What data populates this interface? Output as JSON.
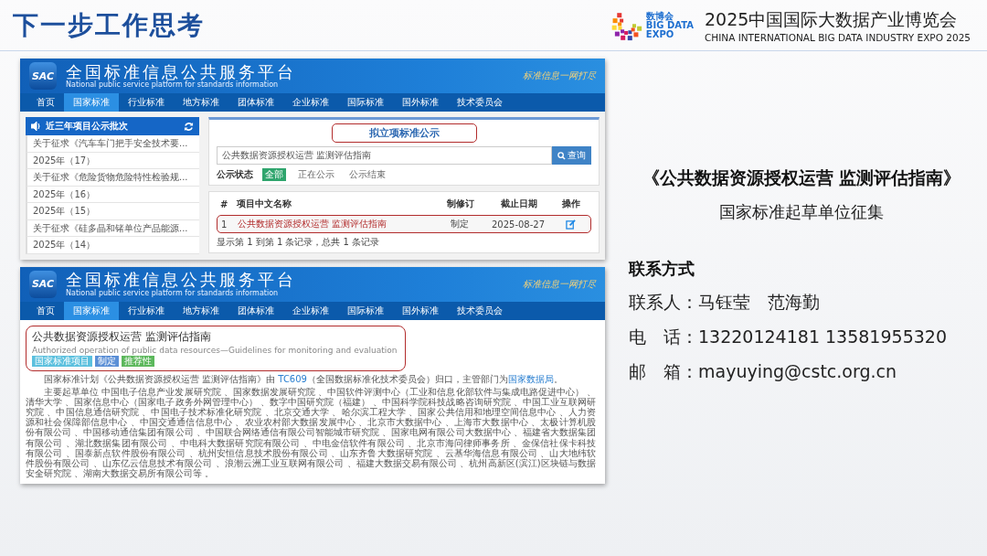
{
  "slide": {
    "title": "下一步工作思考",
    "expo": {
      "badge_lines": [
        "数博会",
        "BIG DATA",
        "EXPO"
      ],
      "title": "2025中国国际大数据产业博览会",
      "subtitle": "CHINA INTERNATIONAL BIG DATA INDUSTRY EXPO 2025"
    }
  },
  "screenshot_1": {
    "header": {
      "logo": "SAC",
      "title": "全国标准信息公共服务平台",
      "subtitle": "National public service platform  for standards information",
      "slogan": "标准信息一网打尽"
    },
    "nav": [
      {
        "label": "首页",
        "selected": false
      },
      {
        "label": "国家标准",
        "selected": true
      },
      {
        "label": "行业标准",
        "selected": false
      },
      {
        "label": "地方标准",
        "selected": false
      },
      {
        "label": "团体标准",
        "selected": false
      },
      {
        "label": "企业标准",
        "selected": false
      },
      {
        "label": "国际标准",
        "selected": false
      },
      {
        "label": "国外标准",
        "selected": false
      },
      {
        "label": "技术委员会",
        "selected": false
      }
    ],
    "sidebar": {
      "title": "近三年项目公示批次",
      "items": [
        "关于征求《汽车车门把手安全技术要...",
        "2025年（17）",
        "关于征求《危险货物危险特性检验规...",
        "2025年（16）",
        "2025年（15）",
        "关于征求《硅多晶和锗单位产品能源...",
        "2025年（14）"
      ]
    },
    "panel": {
      "title": "拟立项标准公示",
      "highlighted": true,
      "search": {
        "value": "公共数据资源授权运营 监测评估指南",
        "button": "查询"
      },
      "filter": {
        "label": "公示状态",
        "options": [
          {
            "label": "全部",
            "selected": true
          },
          {
            "label": "正在公示",
            "selected": false
          },
          {
            "label": "公示结束",
            "selected": false
          }
        ]
      }
    },
    "table": {
      "columns": [
        "#",
        "项目中文名称",
        "制修订",
        "截止日期",
        "操作"
      ],
      "rows": [
        {
          "cells": [
            "1",
            "公共数据资源授权运营 监测评估指南",
            "制定",
            "2025-08-27"
          ],
          "highlighted": true
        }
      ],
      "footer": "显示第 1 到第 1 条记录，总共 1 条记录"
    }
  },
  "screenshot_2": {
    "header": {
      "logo": "SAC",
      "title": "全国标准信息公共服务平台",
      "subtitle": "National public service platform  for standards information",
      "slogan": "标准信息一网打尽"
    },
    "nav": [
      {
        "label": "首页",
        "selected": false
      },
      {
        "label": "国家标准",
        "selected": true
      },
      {
        "label": "行业标准",
        "selected": false
      },
      {
        "label": "地方标准",
        "selected": false
      },
      {
        "label": "团体标准",
        "selected": false
      },
      {
        "label": "企业标准",
        "selected": false
      },
      {
        "label": "国际标准",
        "selected": false
      },
      {
        "label": "国外标准",
        "selected": false
      },
      {
        "label": "技术委员会",
        "selected": false
      }
    ],
    "standard": {
      "title": "公共数据资源授权运营 监测评估指南",
      "english": "Authorized operation of public data resources—Guidelines for monitoring and evaluation",
      "highlighted": true,
      "tags": [
        {
          "label": "国家标准项目",
          "color": "#5bc0de"
        },
        {
          "label": "制定",
          "color": "#5b8fd6"
        },
        {
          "label": "推荐性",
          "color": "#5cb85c"
        }
      ]
    },
    "paragraphs": [
      [
        {
          "kind": "text",
          "text": "国家标准计划《公共数据资源授权运营 监测评估指南》由 "
        },
        {
          "kind": "link",
          "text": "TC609"
        },
        {
          "kind": "text",
          "text": "（全国数据标准化技术委员会）归口，主管部门为"
        },
        {
          "kind": "link",
          "text": "国家数据局"
        },
        {
          "kind": "text",
          "text": "。"
        }
      ],
      [
        {
          "kind": "text",
          "text": "主要起草单位 中国电子信息产业发展研究院 、国家数据发展研究院 、中国软件评测中心（工业和信息化部软件与集成电路促进中心） 、清华大学 、国家信息中心（国家电子政务外网管理中心） 、数字中国研究院（福建） 、中国科学院科技战略咨询研究院 、中国工业互联网研究院 、中国信息通信研究院 、中国电子技术标准化研究院 、北京交通大学 、哈尔滨工程大学 、国家公共信用和地理空间信息中心 、人力资源和社会保障部信息中心 、中国交通通信信息中心 、农业农村部大数据发展中心 、北京市大数据中心 、上海市大数据中心 、太极计算机股份有限公司 、中国移动通信集团有限公司 、中国联合网络通信有限公司智能城市研究院 、国家电网有限公司大数据中心 、福建省大数据集团有限公司 、湖北数据集团有限公司 、中电科大数据研究院有限公司 、中电金信软件有限公司 、北京市海问律师事务所 、金保信社保卡科技有限公司 、国泰新点软件股份有限公司 、杭州安恒信息技术股份有限公司 、山东齐鲁大数据研究院 、云基华海信息有限公司 、山大地纬软件股份有限公司 、山东亿云信息技术有限公司 、浪潮云洲工业互联网有限公司 、福建大数据交易有限公司 、杭州高新区(滨江)区块链与数据安全研究院 、湖南大数据交易所有限公司等 。"
        }
      ]
    ]
  },
  "info": {
    "heading": "《公共数据资源授权运营 监测评估指南》",
    "subheading": "国家标准起草单位征集",
    "contact_title": "联系方式",
    "contact_lines": [
      "联系人：马钰莹　范海勤",
      "电　话：13220124181 13581955320",
      "邮　箱：mayuying@cstc.org.cn"
    ]
  }
}
